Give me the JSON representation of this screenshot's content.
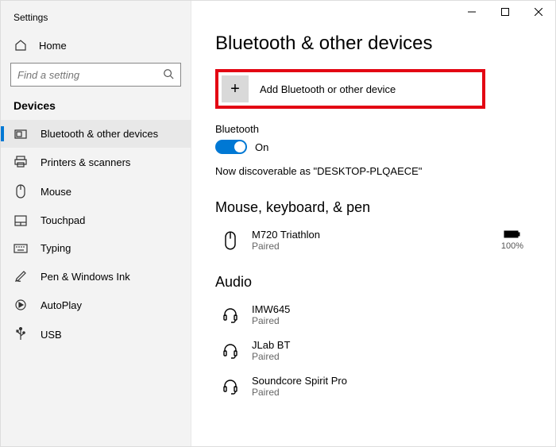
{
  "app_title": "Settings",
  "home_label": "Home",
  "search": {
    "placeholder": "Find a setting"
  },
  "section_header": "Devices",
  "sidebar": {
    "items": [
      {
        "label": "Bluetooth & other devices",
        "icon": "rect"
      },
      {
        "label": "Printers & scanners",
        "icon": "printer"
      },
      {
        "label": "Mouse",
        "icon": "mouse"
      },
      {
        "label": "Touchpad",
        "icon": "touchpad"
      },
      {
        "label": "Typing",
        "icon": "keyboard"
      },
      {
        "label": "Pen & Windows Ink",
        "icon": "pen"
      },
      {
        "label": "AutoPlay",
        "icon": "autoplay"
      },
      {
        "label": "USB",
        "icon": "usb"
      }
    ]
  },
  "page_heading": "Bluetooth & other devices",
  "add_device_label": "Add Bluetooth or other device",
  "bluetooth_label": "Bluetooth",
  "toggle_state_label": "On",
  "discoverable_text": "Now discoverable as \"DESKTOP-PLQAECE\"",
  "group_mouse_heading": "Mouse, keyboard, & pen",
  "devices_mouse": [
    {
      "name": "M720 Triathlon",
      "status": "Paired",
      "battery": "100%"
    }
  ],
  "group_audio_heading": "Audio",
  "devices_audio": [
    {
      "name": "IMW645",
      "status": "Paired"
    },
    {
      "name": "JLab BT",
      "status": "Paired"
    },
    {
      "name": "Soundcore Spirit Pro",
      "status": "Paired"
    }
  ]
}
